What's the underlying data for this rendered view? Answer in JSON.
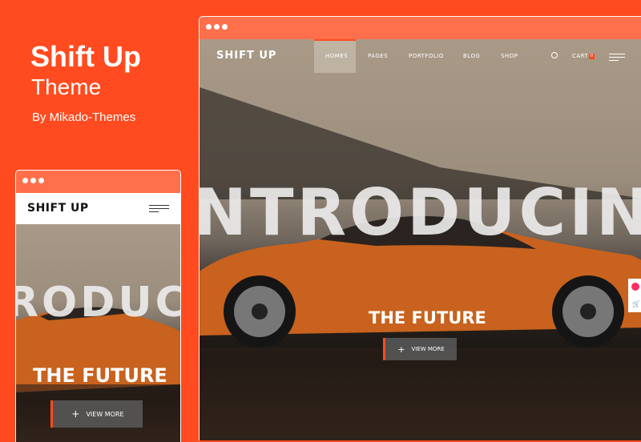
{
  "promo": {
    "title": "Shift Up",
    "subtitle": "Theme",
    "author": "By Mikado-Themes"
  },
  "desktop": {
    "logo": "SHIFT UP",
    "nav": [
      "HOMES",
      "PAGES",
      "PORTFOLIO",
      "BLOG",
      "SHOP"
    ],
    "cart_label": "CART",
    "cart_count": "0",
    "hero_bg_text": "NTRODUCIN",
    "hero_title": "THE FUTURE",
    "cta": "VIEW MORE"
  },
  "mobile": {
    "logo": "SHIFT UP",
    "hero_bg_text": "RODUC",
    "hero_title": "THE FUTURE",
    "cta": "VIEW MORE"
  },
  "colors": {
    "brand": "#ff4b1f",
    "titlebar": "#ff6f4b"
  }
}
